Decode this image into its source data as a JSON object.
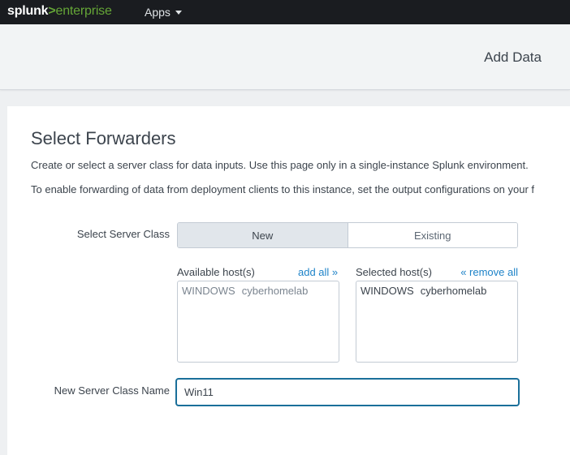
{
  "nav": {
    "logo_splunk": "splunk",
    "logo_gt": ">",
    "logo_enterprise": "enterprise",
    "apps_label": "Apps"
  },
  "header": {
    "title": "Add Data"
  },
  "main": {
    "title": "Select Forwarders",
    "description_1": "Create or select a server class for data inputs. Use this page only in a single-instance Splunk environment.",
    "description_2": "To enable forwarding of data from deployment clients to this instance, set the output configurations on your f",
    "server_class_label": "Select Server Class",
    "server_class_options": [
      "New",
      "Existing"
    ],
    "server_class_selected": "New",
    "available_hosts_label": "Available host(s)",
    "add_all_label": "add all »",
    "selected_hosts_label": "Selected host(s)",
    "remove_all_label": "« remove all",
    "available_hosts": [
      {
        "os": "WINDOWS",
        "name": "cyberhomelab"
      }
    ],
    "selected_hosts": [
      {
        "os": "WINDOWS",
        "name": "cyberhomelab"
      }
    ],
    "new_server_class_label": "New Server Class Name",
    "new_server_class_value": "Win11"
  },
  "colors": {
    "topbar": "#1a1c20",
    "brand_green": "#65a637",
    "link_blue": "#1e83c8",
    "focus_border": "#1a6f9a"
  }
}
